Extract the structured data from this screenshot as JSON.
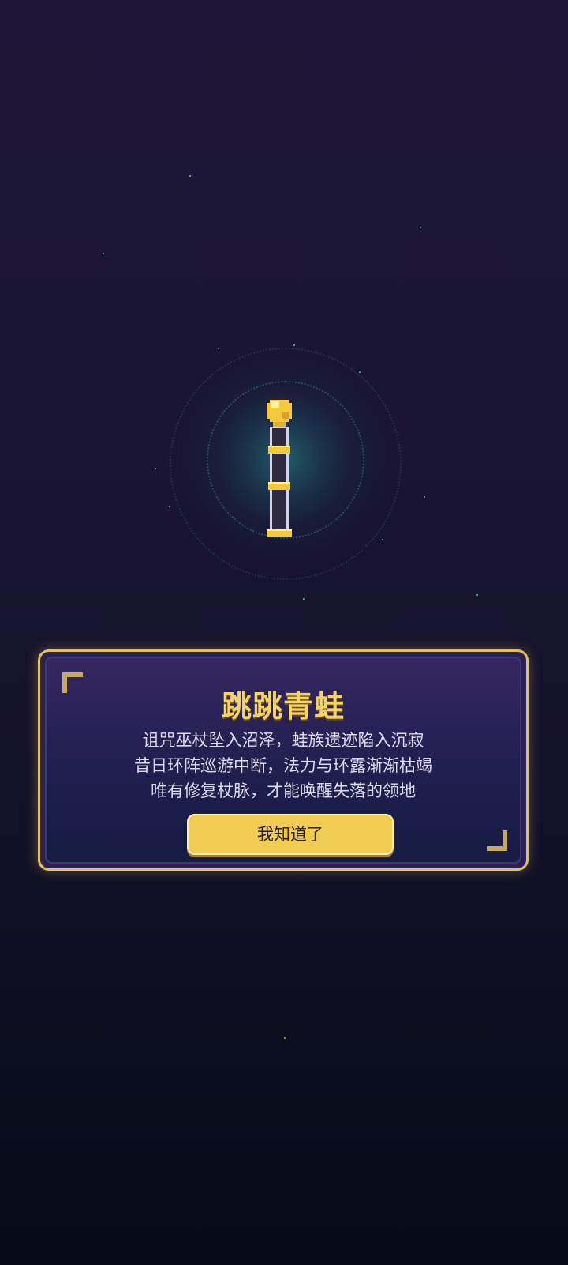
{
  "dialog": {
    "title": "跳跳青蛙",
    "story_lines": [
      "诅咒巫杖坠入沼泽，蛙族遗迹陷入沉寂",
      "昔日环阵巡游中断，法力与环露渐渐枯竭",
      "唯有修复杖脉，才能唤醒失落的领地"
    ],
    "confirm_label": "我知道了"
  },
  "item": {
    "icon": "golden-staff-icon"
  },
  "colors": {
    "accent_gold": "#f1cc55",
    "title_gold": "#f4d465",
    "orb_teal": "#2f9a9a",
    "background_top": "#1e1638",
    "background_bottom": "#060b18"
  }
}
